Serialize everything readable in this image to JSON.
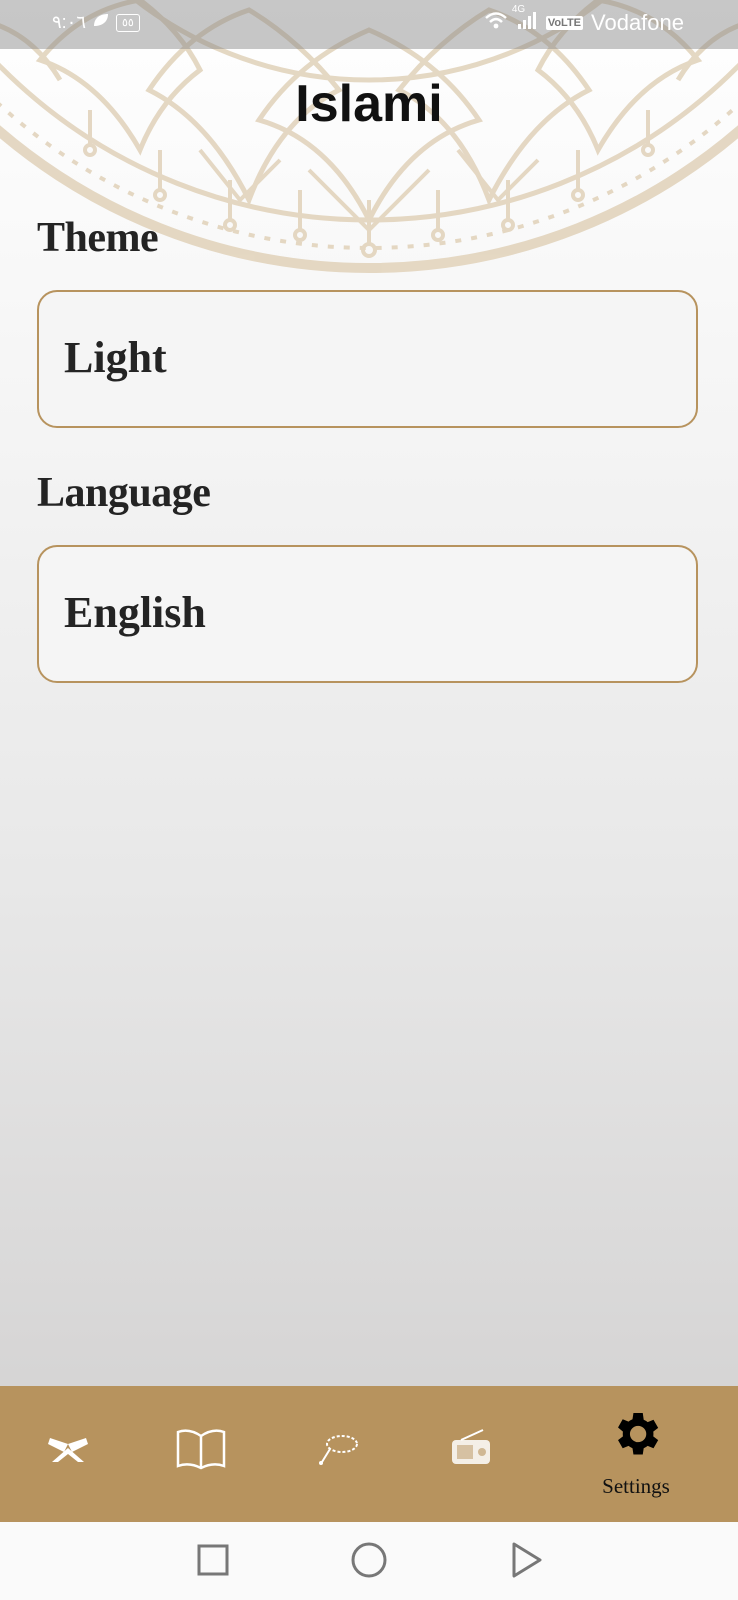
{
  "status_bar": {
    "time": "٩:٠٦",
    "battery": "٥٥",
    "network": "4G",
    "volte": "VoLTE",
    "carrier": "Vodafone"
  },
  "app": {
    "title": "Islami"
  },
  "settings": {
    "theme": {
      "label": "Theme",
      "value": "Light"
    },
    "language": {
      "label": "Language",
      "value": "English"
    }
  },
  "bottom_nav": {
    "items": [
      {
        "icon": "quran-icon",
        "label": ""
      },
      {
        "icon": "hadith-book-icon",
        "label": ""
      },
      {
        "icon": "sebha-icon",
        "label": ""
      },
      {
        "icon": "radio-icon",
        "label": ""
      },
      {
        "icon": "gear-icon",
        "label": "Settings",
        "selected": true
      }
    ]
  },
  "colors": {
    "accent": "#b7935e",
    "text": "#242424",
    "mandala": "#e2d4bd"
  }
}
